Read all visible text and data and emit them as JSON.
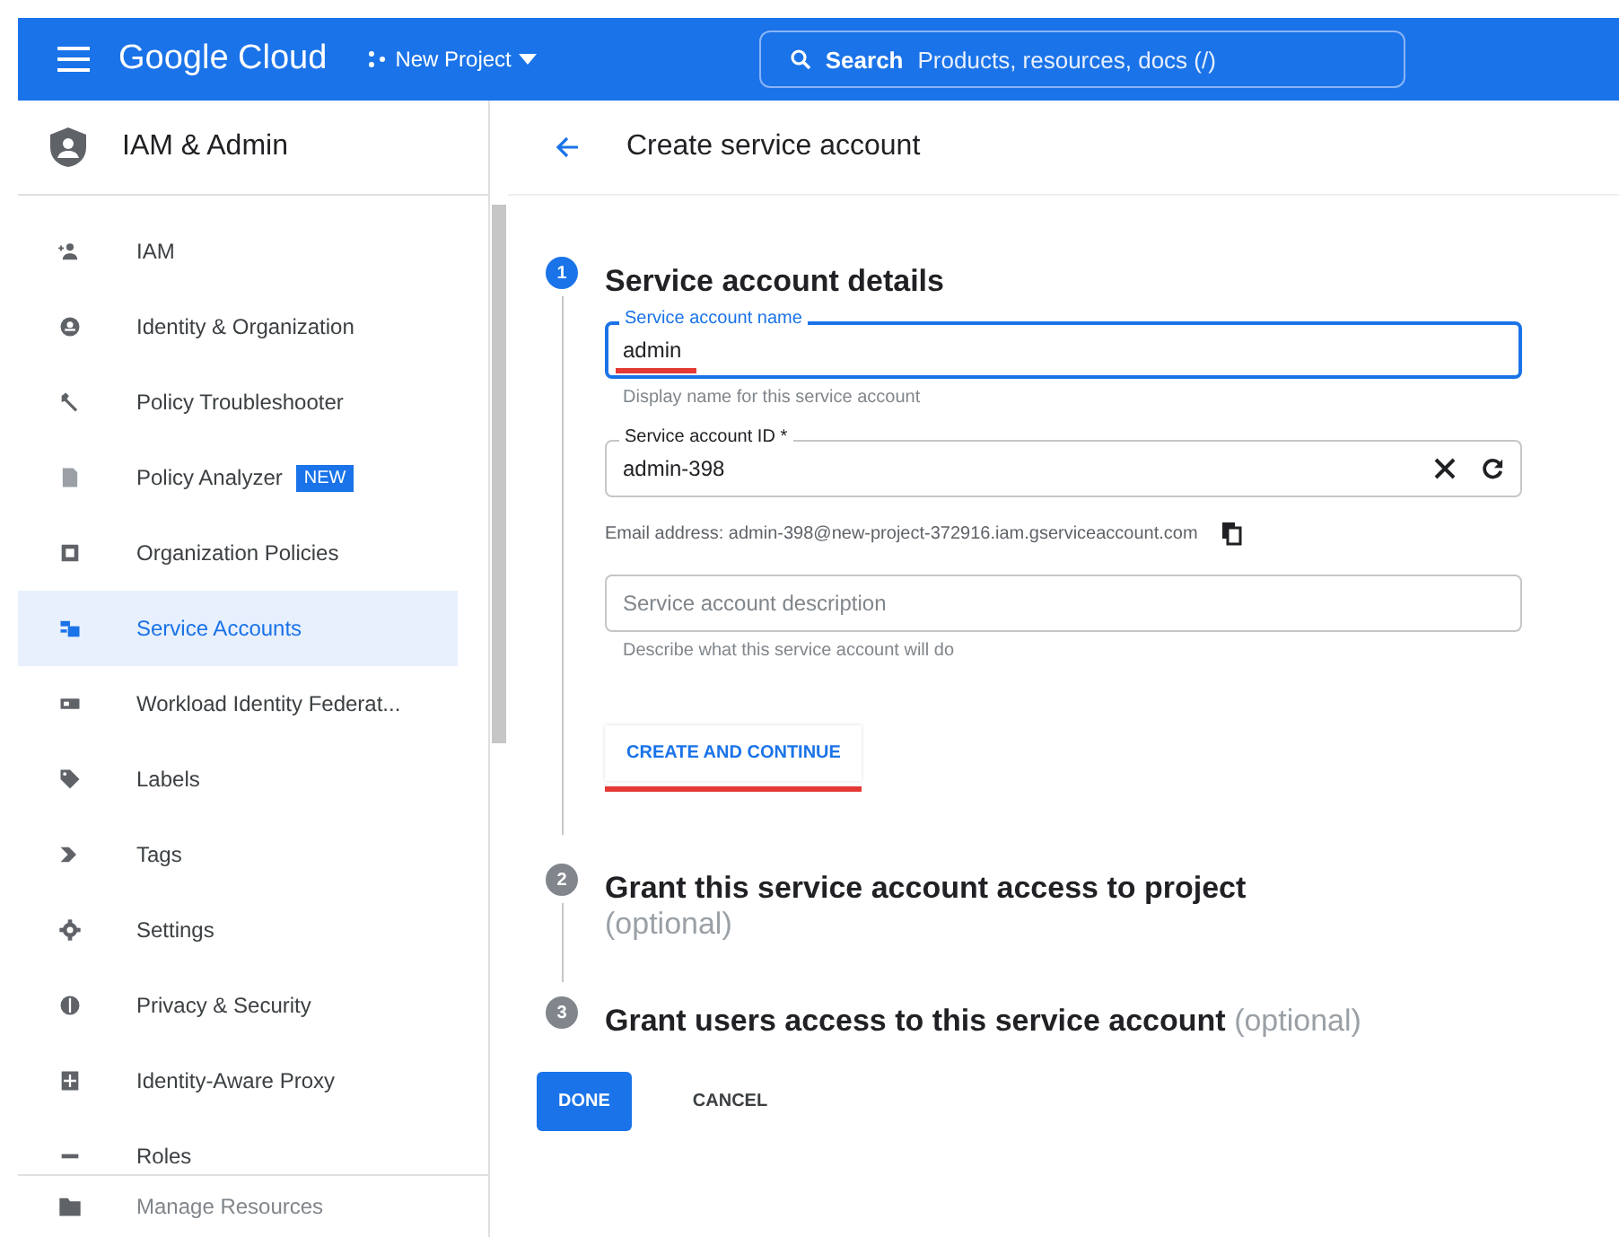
{
  "topbar": {
    "brand": "Google Cloud",
    "project": "New Project",
    "search_label": "Search",
    "search_placeholder": "Products, resources, docs (/)"
  },
  "sidebar": {
    "title": "IAM & Admin",
    "items": [
      {
        "label": "IAM",
        "selected": false
      },
      {
        "label": "Identity & Organization",
        "selected": false
      },
      {
        "label": "Policy Troubleshooter",
        "selected": false
      },
      {
        "label": "Policy Analyzer",
        "badge": "NEW",
        "selected": false
      },
      {
        "label": "Organization Policies",
        "selected": false
      },
      {
        "label": "Service Accounts",
        "selected": true
      },
      {
        "label": "Workload Identity Federat...",
        "selected": false
      },
      {
        "label": "Labels",
        "selected": false
      },
      {
        "label": "Tags",
        "selected": false
      },
      {
        "label": "Settings",
        "selected": false
      },
      {
        "label": "Privacy & Security",
        "selected": false
      },
      {
        "label": "Identity-Aware Proxy",
        "selected": false
      },
      {
        "label": "Roles",
        "selected": false
      }
    ],
    "footer": "Manage Resources"
  },
  "page": {
    "title": "Create service account"
  },
  "steps": [
    {
      "number": "1",
      "title": "Service account details",
      "active": true
    },
    {
      "number": "2",
      "title": "Grant this service account access to project",
      "optional": "(optional)",
      "active": false
    },
    {
      "number": "3",
      "title": "Grant users access to this service account",
      "optional": "(optional)",
      "active": false
    }
  ],
  "form": {
    "name_field": {
      "label": "Service account name",
      "value": "admin",
      "focused": true,
      "underlined": true,
      "hint": "Display name for this service account"
    },
    "id_field": {
      "label": "Service account ID *",
      "value": "admin-398"
    },
    "email": "Email address: admin-398@new-project-372916.iam.gserviceaccount.com",
    "description_field": {
      "placeholder": "Service account description",
      "hint": "Describe what this service account will do"
    },
    "create_button": {
      "label": "CREATE AND CONTINUE",
      "underlined": true
    }
  },
  "buttons": [
    {
      "label": "DONE",
      "kind": "primary"
    },
    {
      "label": "CANCEL",
      "kind": "text"
    }
  ]
}
